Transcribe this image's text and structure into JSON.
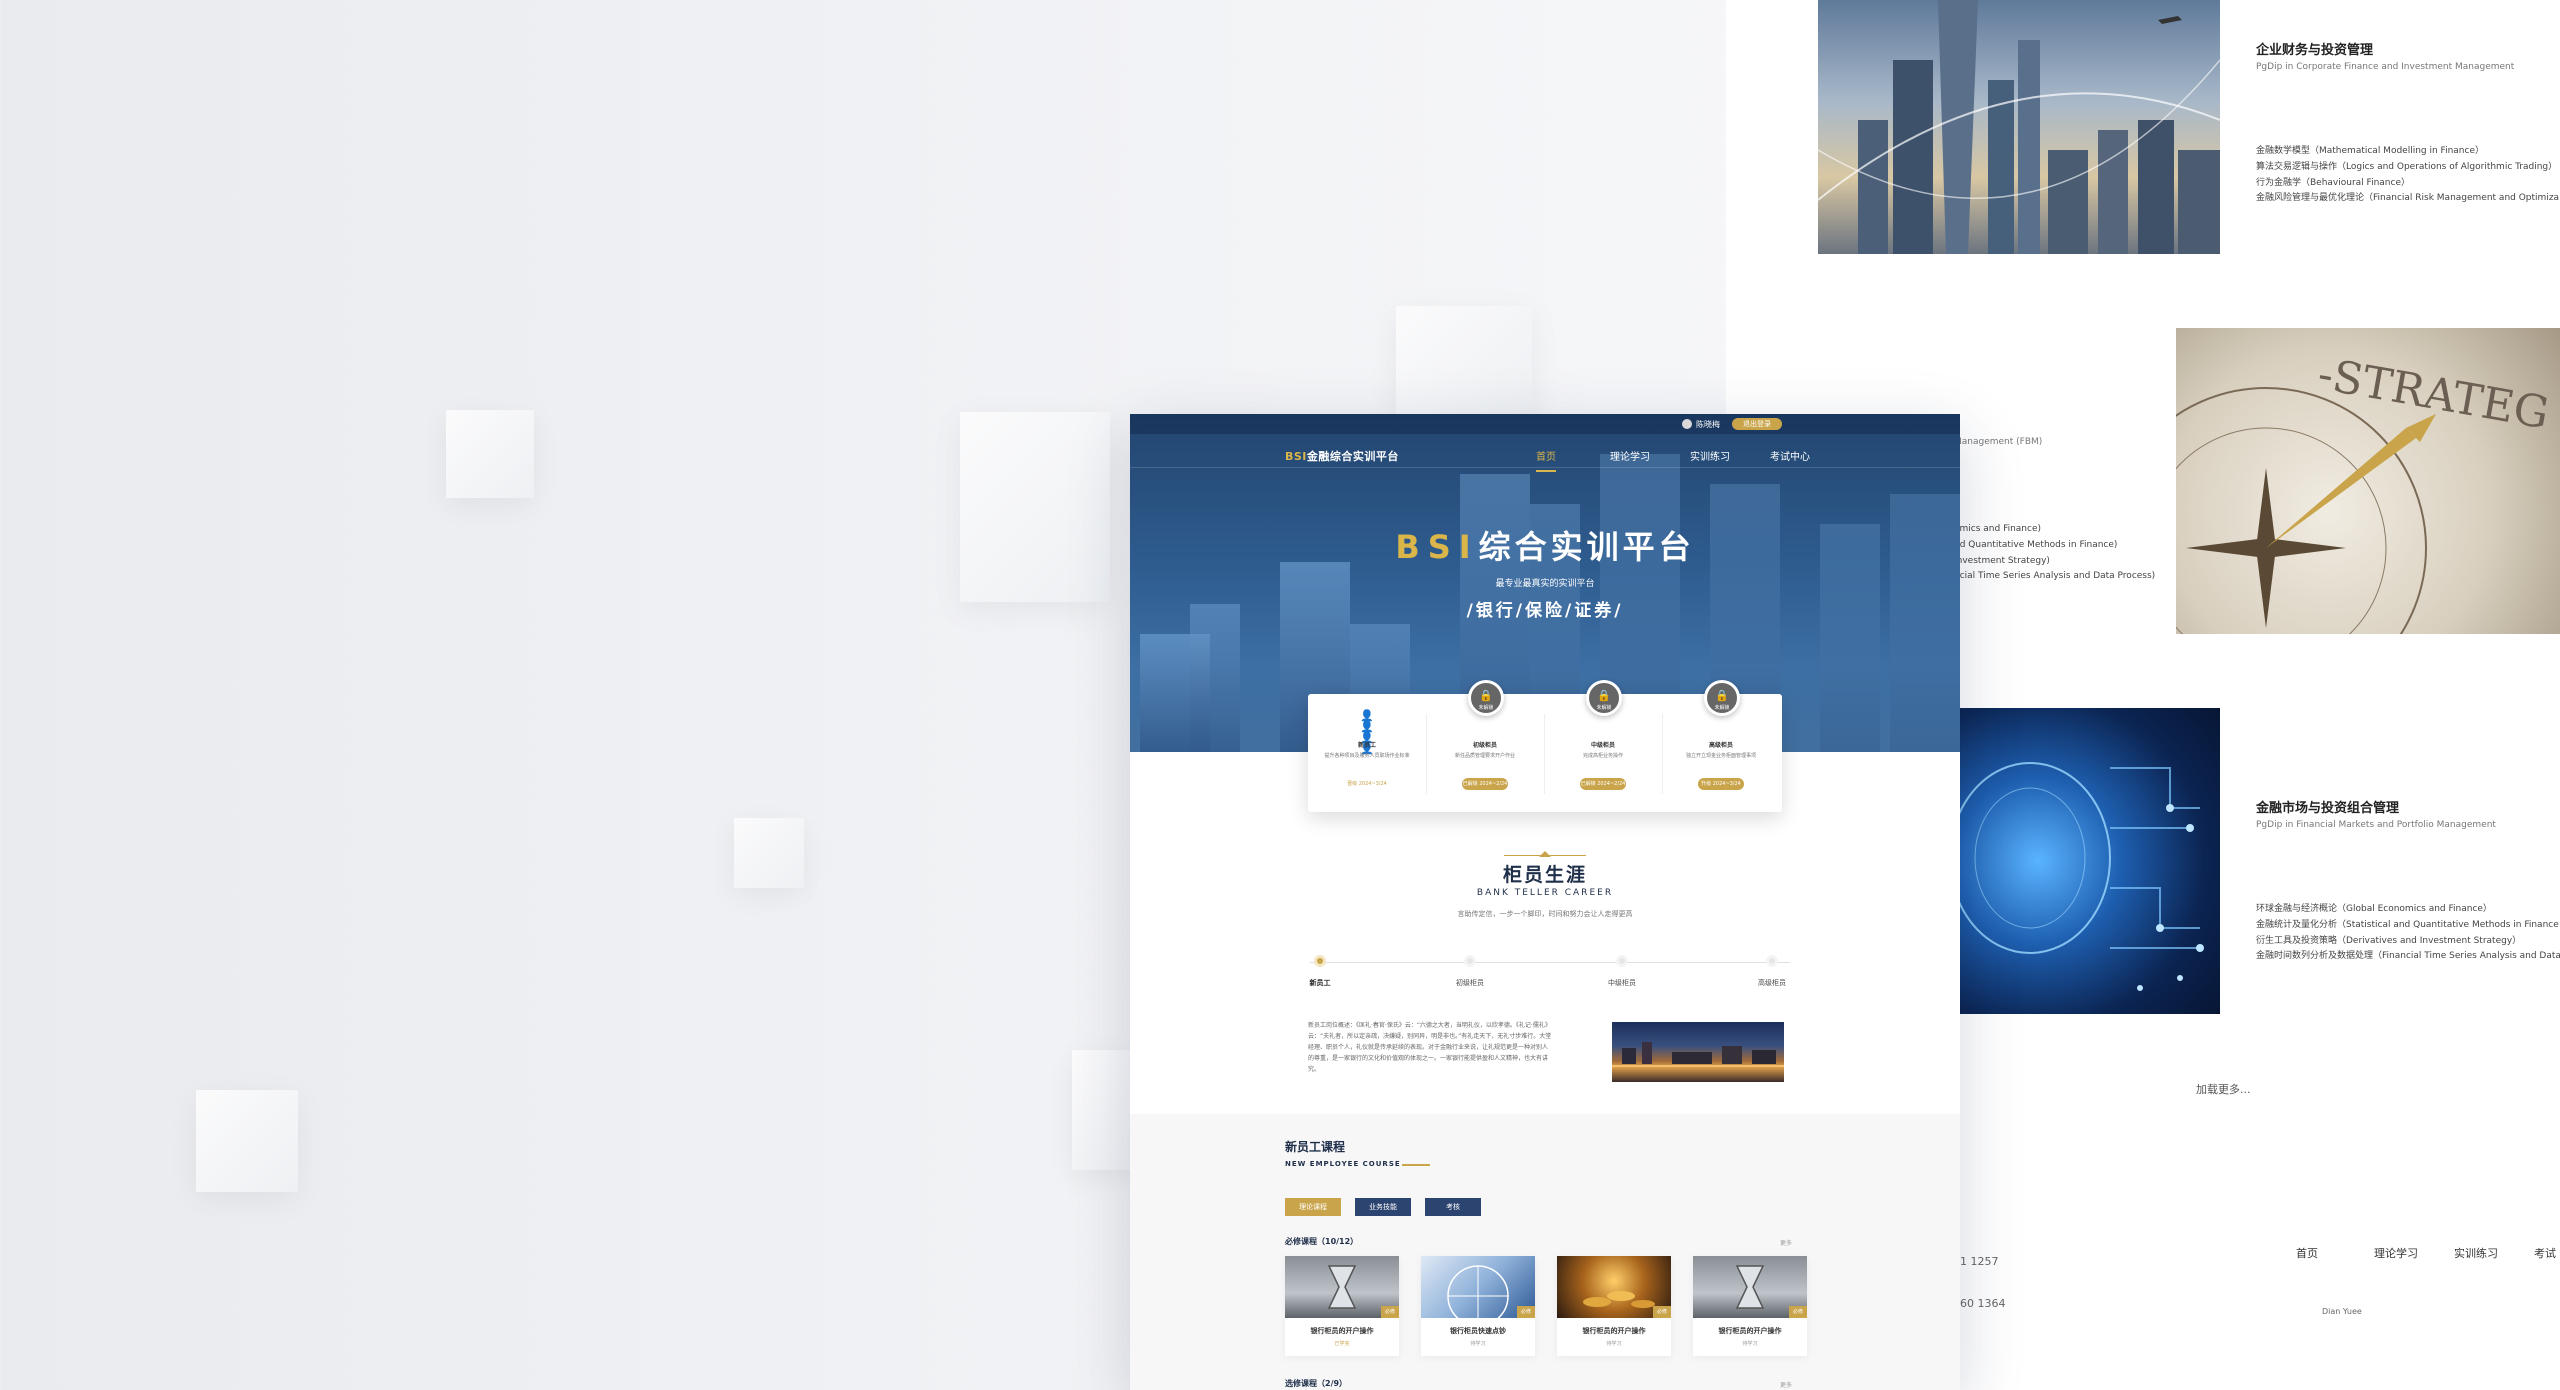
{
  "right_panel": {
    "course1": {
      "title": "企业财务与投资管理",
      "subtitle": "PgDip in Corporate Finance and Investment Management",
      "items": [
        "金融数学模型（Mathematical Modelling in Finance）",
        "算法交易逻辑与操作（Logics and Operations of Algorithmic Trading）",
        "行为金融学（Behavioural Finance）",
        "金融风险管理与最优化理论（Financial Risk Management and Optimiza"
      ]
    },
    "course2": {
      "subtitle_fragment": "Management (FBM)",
      "items": [
        "omics and Finance)",
        "nd Quantitative Methods in Finance)",
        "Investment Strategy)",
        "ncial Time Series Analysis and Data Process)"
      ]
    },
    "course3": {
      "title": "金融市场与投资组合管理",
      "subtitle": "PgDip in Financial Markets and Portfolio Management",
      "items": [
        "环球金融与经济概论（Global Economics and Finance）",
        "金融统计及量化分析（Statistical and Quantitative Methods in Finance",
        "衍生工具及投资策略（Derivatives and Investment Strategy）",
        "金融时间数列分析及数据处理（Financial Time Series Analysis and Data"
      ]
    },
    "load_more": "加载更多...",
    "phone1": "1 1257",
    "phone2": "60 1364",
    "footer_nav": [
      "首页",
      "理论学习",
      "实训练习",
      "考试"
    ],
    "footer_name": "Dian Yuee"
  },
  "mock": {
    "user_name": "陈晓梅",
    "top_button": "退出登录",
    "logo_gold": "BSI",
    "logo_text": "金融综合实训平台",
    "nav": [
      "首页",
      "理论学习",
      "实训练习",
      "考试中心"
    ],
    "hero_title_gold": "BSI",
    "hero_title": "综合实训平台",
    "hero_sub": "最专业最真实的实训平台",
    "hero_tags": "/银行/保险/证券/",
    "levels": [
      {
        "name": "新员工",
        "desc": "提升各种项目及服务人员职场作业标准",
        "pill": "晋级 2024~3/24",
        "locked": false,
        "lock_label": ""
      },
      {
        "name": "初级柜员",
        "desc": "新任品质管理要求开户作业",
        "pill": "已解锁 2024~2/24",
        "locked": true,
        "lock_label": "未解锁"
      },
      {
        "name": "中级柜员",
        "desc": "完成高柜业务操作",
        "pill": "已解锁 2024~2/24",
        "locked": true,
        "lock_label": "未解锁"
      },
      {
        "name": "高级柜员",
        "desc": "独立开立现金业务柜面管理事项",
        "pill": "升级 2024~3/24",
        "locked": true,
        "lock_label": "未解锁"
      }
    ],
    "section_title": "柜员生涯",
    "section_en": "BANK TELLER CAREER",
    "section_desc": "言助传定信，一步一个脚印，时间和努力会让人走得更高",
    "timeline": [
      "新员工",
      "初级柜员",
      "中级柜员",
      "高级柜员"
    ],
    "intro_text": "新员工岗位概述：《匡礼·春官·保氏》云：“六德之大者，当明礼仪，以欣孝德。《礼记·儒礼》云：“夫礼者，所以定亲疏，决嫌疑，别同异，明是非也。”有礼走天下，无礼寸步难行。大堂经理、职员个人，礼仪就是传承延续的表现。对于金融行业来说，让礼规范更是一种对别人的尊重，是一家银行的文化和价值观的体现之一。一家银行能提供盈和人文精神，也大有讲究。",
    "course_title": "新员工课程",
    "course_en": "NEW EMPLOYEE COURSE",
    "tabs": [
      "理论课程",
      "业务技能",
      "考核"
    ],
    "required_title": "必修课程（10/12）",
    "optional_title": "选修课程（2/9）",
    "more_label": "更多",
    "cards": [
      {
        "name": "银行柜员的开户操作",
        "meta": "已学完",
        "badge": "必修"
      },
      {
        "name": "银行柜员快速点钞",
        "meta": "待学习",
        "badge": "必修"
      },
      {
        "name": "银行柜员的开户操作",
        "meta": "待学习",
        "badge": "必修"
      },
      {
        "name": "银行柜员的开户操作",
        "meta": "待学习",
        "badge": "必修"
      }
    ]
  },
  "colors": {
    "navy": "#1f2f4a",
    "gold": "#c9a44a",
    "tab_navy": "#2c4470"
  }
}
